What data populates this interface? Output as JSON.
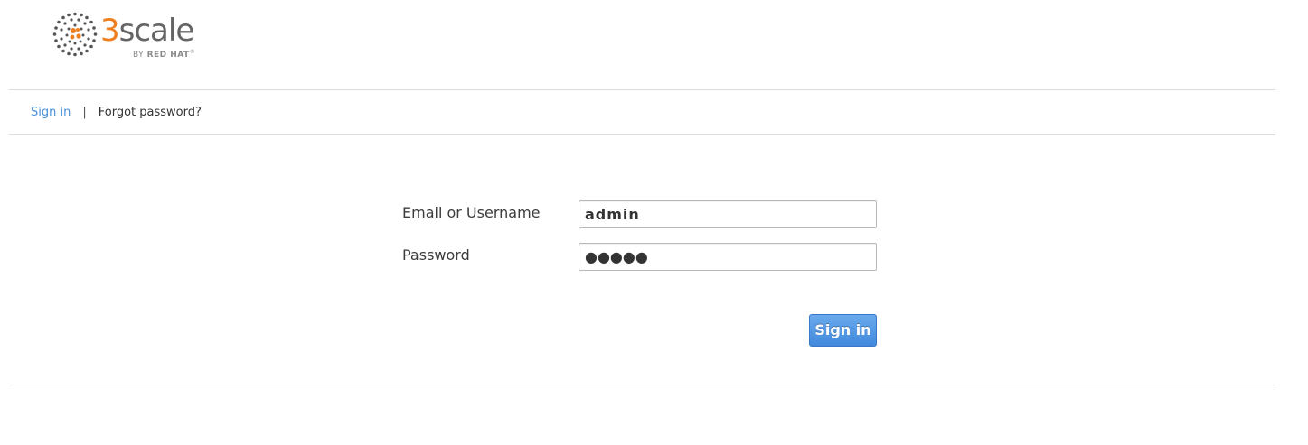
{
  "brand": {
    "name_prefix": "3",
    "name_rest": "scale",
    "tagline_by": "BY",
    "tagline_company": "RED HAT",
    "tagline_mark": "®",
    "accent_color": "#ee7f1e",
    "logo_icon": "dots-sphere-icon"
  },
  "nav": {
    "signin_label": "Sign in",
    "separator": "|",
    "forgot_label": "Forgot password?",
    "link_color": "#4a90d9"
  },
  "form": {
    "username_label": "Email or Username",
    "username_value": "admin",
    "password_label": "Password",
    "password_masked": "●●●●●",
    "submit_label": "Sign in",
    "button_color": "#4a8fdf"
  }
}
